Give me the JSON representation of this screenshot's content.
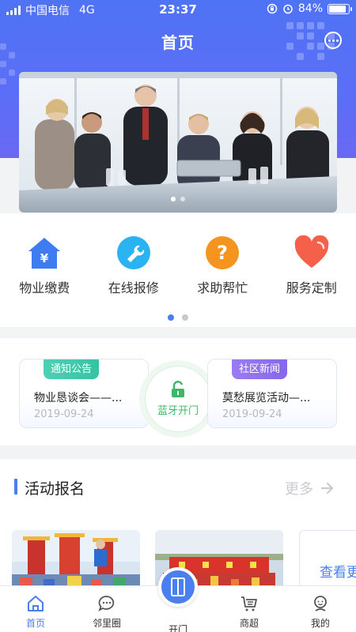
{
  "status_bar": {
    "carrier": "中国电信",
    "network": "4G",
    "time": "23:37",
    "battery": "84%"
  },
  "header": {
    "title": "首页",
    "more_icon": "more-dots-icon"
  },
  "banner": {
    "image": "business-meeting-photo",
    "slide_count": 2,
    "active_slide": 0
  },
  "services": {
    "items": [
      {
        "label": "物业缴费",
        "icon": "house-yen-icon",
        "color": "#3f7cf2"
      },
      {
        "label": "在线报修",
        "icon": "wrench-icon",
        "color": "#2bb2f0"
      },
      {
        "label": "求助帮忙",
        "icon": "question-icon",
        "color": "#f5941e"
      },
      {
        "label": "服务定制",
        "icon": "heart-icon",
        "color": "#f4604a"
      }
    ],
    "page_count": 2,
    "active_page": 0
  },
  "news": {
    "notice": {
      "tag": "通知公告",
      "title": "物业恳谈会——...",
      "date": "2019-09-24"
    },
    "bluetooth": {
      "label": "蓝牙开门",
      "icon": "unlock-icon",
      "color": "#3cb866"
    },
    "community": {
      "tag": "社区新闻",
      "title": "莫愁展览活动—...",
      "date": "2019-09-24"
    }
  },
  "activity": {
    "title": "活动报名",
    "more": "更多",
    "see_more": "查看更多",
    "accent": "#4a7ff0"
  },
  "tabbar": {
    "items": [
      {
        "label": "首页",
        "icon": "home-icon",
        "active": true
      },
      {
        "label": "邻里圈",
        "icon": "chat-bubble-icon",
        "active": false
      },
      {
        "label": "开门",
        "icon": "door-icon",
        "active": false
      },
      {
        "label": "商超",
        "icon": "cart-icon",
        "active": false
      },
      {
        "label": "我的",
        "icon": "user-icon",
        "active": false
      }
    ]
  }
}
